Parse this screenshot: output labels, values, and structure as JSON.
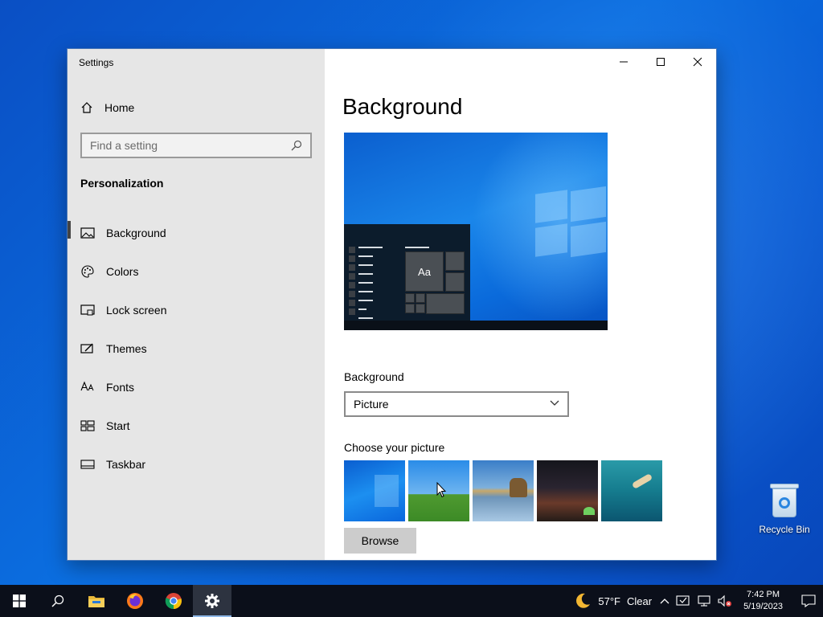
{
  "window": {
    "title": "Settings"
  },
  "sidebar": {
    "home_label": "Home",
    "search_placeholder": "Find a setting",
    "section_title": "Personalization",
    "items": [
      {
        "label": "Background",
        "icon": "picture-icon"
      },
      {
        "label": "Colors",
        "icon": "palette-icon"
      },
      {
        "label": "Lock screen",
        "icon": "lock-screen-icon"
      },
      {
        "label": "Themes",
        "icon": "themes-icon"
      },
      {
        "label": "Fonts",
        "icon": "fonts-icon"
      },
      {
        "label": "Start",
        "icon": "start-icon"
      },
      {
        "label": "Taskbar",
        "icon": "taskbar-icon"
      }
    ],
    "active_index": 0
  },
  "content": {
    "page_title": "Background",
    "preview_tile_text": "Aa",
    "background_label": "Background",
    "background_value": "Picture",
    "choose_label": "Choose your picture",
    "thumbnails": [
      "windows-blue",
      "green-hill",
      "beach-rocks",
      "night-sky-tent",
      "underwater-diver"
    ],
    "browse_label": "Browse"
  },
  "desktop": {
    "recycle_bin_label": "Recycle Bin"
  },
  "taskbar": {
    "weather_temp": "57°F",
    "weather_desc": "Clear",
    "time": "7:42 PM",
    "date": "5/19/2023",
    "pinned": [
      "file-explorer-icon",
      "firefox-icon",
      "chrome-icon",
      "settings-icon"
    ]
  },
  "colors": {
    "accent": "#0078d7",
    "sidebar_bg": "#e6e6e6",
    "taskbar_bg": "#0b0f1a"
  }
}
